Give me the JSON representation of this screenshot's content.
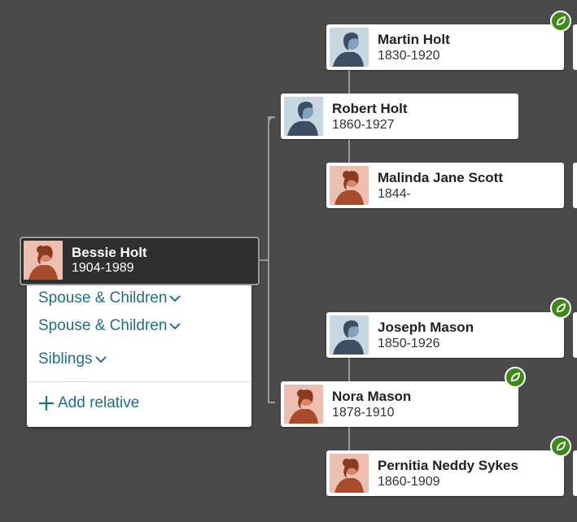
{
  "colors": {
    "background": "#4a4a4a",
    "card": "#ffffff",
    "selected_card": "#2f2f2f",
    "link": "#1f6f8b",
    "hint": "#3d8a16",
    "male_avatar_bg": "#c6d7e2",
    "female_avatar_bg": "#edbfb0"
  },
  "people": {
    "bessie": {
      "name": "Bessie Holt",
      "dates": "1904-1989",
      "gender": "female",
      "selected": true
    },
    "robert": {
      "name": "Robert Holt",
      "dates": "1860-1927",
      "gender": "male"
    },
    "martin": {
      "name": "Martin Holt",
      "dates": "1830-1920",
      "gender": "male",
      "hint": true
    },
    "malinda": {
      "name": "Malinda Jane Scott",
      "dates": "1844-",
      "gender": "female"
    },
    "nora": {
      "name": "Nora Mason",
      "dates": "1878-1910",
      "gender": "female",
      "hint": true
    },
    "joseph": {
      "name": "Joseph Mason",
      "dates": "1850-1926",
      "gender": "male",
      "hint": true
    },
    "pernitia": {
      "name": "Pernitia Neddy Sykes",
      "dates": "1860-1909",
      "gender": "female",
      "hint": true
    }
  },
  "panel": {
    "spouse_children_1": "Spouse & Children",
    "spouse_children_2": "Spouse & Children",
    "siblings": "Siblings",
    "add_relative": "Add relative"
  },
  "icons": {
    "hint": "leaf-hint-icon",
    "chevron": "chevron-down-icon",
    "plus": "plus-icon",
    "avatar_male": "male-silhouette-icon",
    "avatar_female": "female-silhouette-icon"
  }
}
